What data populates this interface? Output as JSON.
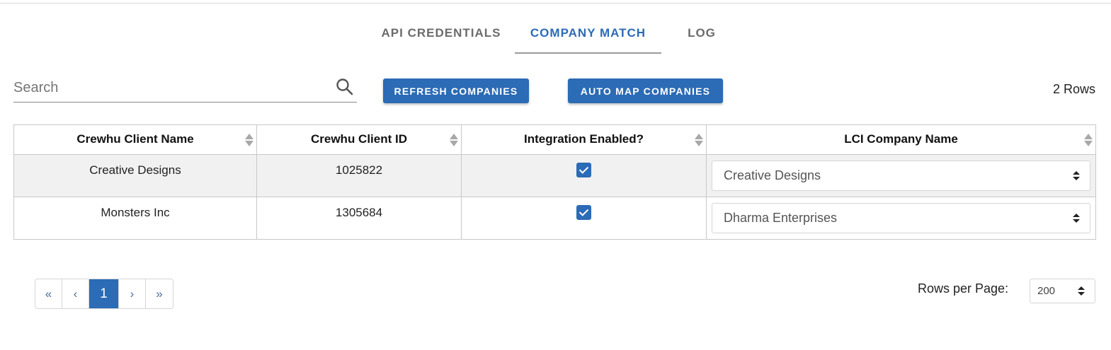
{
  "tabs": [
    {
      "label": "API CREDENTIALS",
      "active": false
    },
    {
      "label": "COMPANY MATCH",
      "active": true
    },
    {
      "label": "LOG",
      "active": false
    }
  ],
  "search": {
    "placeholder": "Search",
    "value": ""
  },
  "toolbar": {
    "refresh_label": "REFRESH COMPANIES",
    "automap_label": "AUTO MAP COMPANIES",
    "row_count": "2 Rows"
  },
  "table": {
    "headers": [
      "Crewhu Client Name",
      "Crewhu Client ID",
      "Integration Enabled?",
      "LCI Company Name"
    ],
    "rows": [
      {
        "client_name": "Creative Designs",
        "client_id": "1025822",
        "enabled": true,
        "lci_company": "Creative Designs"
      },
      {
        "client_name": "Monsters Inc",
        "client_id": "1305684",
        "enabled": true,
        "lci_company": "Dharma Enterprises"
      }
    ]
  },
  "pagination": {
    "first": "«",
    "prev": "‹",
    "current": "1",
    "next": "›",
    "last": "»"
  },
  "rows_per_page": {
    "label": "Rows per Page:",
    "value": "200"
  },
  "colors": {
    "accent": "#2c6bb5",
    "row_shade": "#f1f1f1",
    "border": "#c8c8c8"
  }
}
